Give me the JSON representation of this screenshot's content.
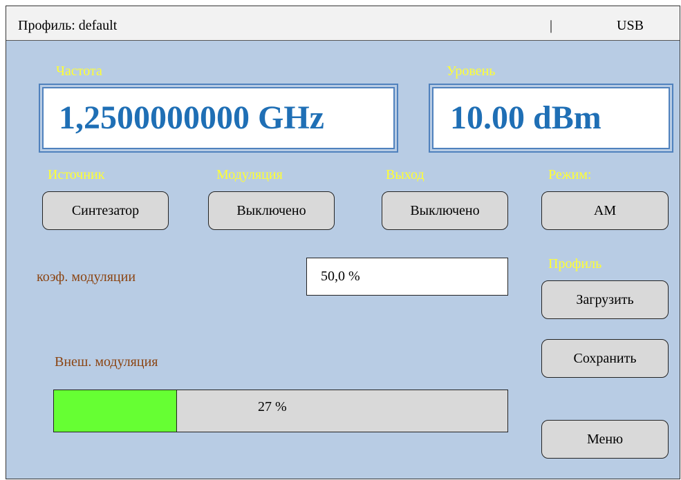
{
  "statusbar": {
    "profile_text": "Профиль: default",
    "separator": "|",
    "connection": "USB"
  },
  "frequency": {
    "label": "Частота",
    "value": "1,2500000000 GHz"
  },
  "level": {
    "label": "Уровень",
    "value": "10.00 dBm"
  },
  "source": {
    "label": "Источник",
    "button": "Синтезатор"
  },
  "modulation": {
    "label": "Модуляция",
    "button": "Выключено"
  },
  "output": {
    "label": "Выход",
    "button": "Выключено"
  },
  "mode": {
    "label": "Режим:",
    "button": "AM"
  },
  "mod_coefficient": {
    "label": "коэф. модуляции",
    "value": "50,0 %"
  },
  "profile": {
    "label": "Профиль",
    "load_button": "Загрузить",
    "save_button": "Сохранить"
  },
  "ext_modulation": {
    "label": "Внеш. модуляция",
    "percent": 27,
    "text": "27 %"
  },
  "menu_button": "Меню",
  "colors": {
    "background": "#b8cce4",
    "accent_label": "#ffff33",
    "value_text": "#1f6fb5",
    "progress_fill": "#66ff33"
  }
}
